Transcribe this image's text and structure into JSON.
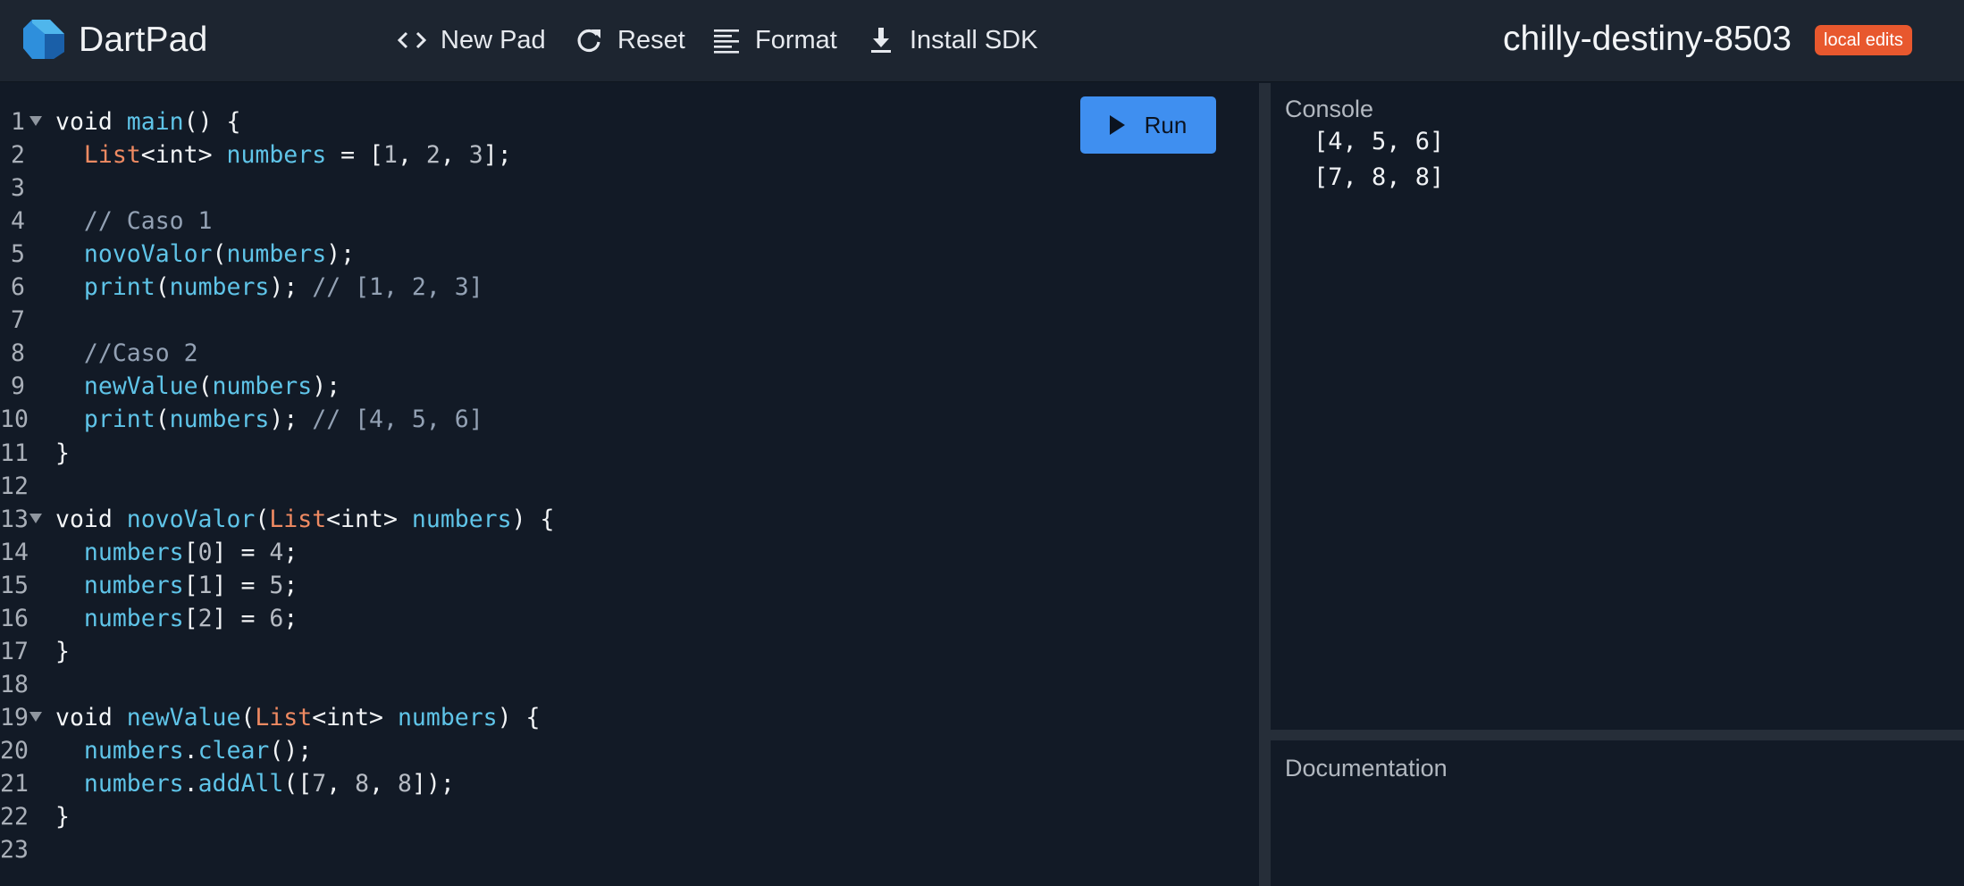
{
  "app": {
    "title": "DartPad",
    "pad_name": "chilly-destiny-8503",
    "badge": "local edits",
    "colors": {
      "header_bg": "#1d2530",
      "editor_bg": "#121a26",
      "run": "#3f8ff0",
      "badge": "#e8582e"
    }
  },
  "toolbar": {
    "new_pad": {
      "label": "New Pad",
      "icon": "code-brackets-icon"
    },
    "reset": {
      "label": "Reset",
      "icon": "refresh-icon"
    },
    "format": {
      "label": "Format",
      "icon": "format-align-icon"
    },
    "install": {
      "label": "Install SDK",
      "icon": "download-icon"
    }
  },
  "editor": {
    "run_label": "Run",
    "lines": [
      {
        "n": "1",
        "fold": true,
        "tokens": [
          [
            "kw",
            "void "
          ],
          [
            "fn",
            "main"
          ],
          [
            "pl",
            "() {"
          ]
        ]
      },
      {
        "n": "2",
        "fold": false,
        "tokens": [
          [
            "pl",
            "  "
          ],
          [
            "ty",
            "List"
          ],
          [
            "pl",
            "<int> "
          ],
          [
            "fn",
            "numbers"
          ],
          [
            "pl",
            " = ["
          ],
          [
            "num",
            "1"
          ],
          [
            "pl",
            ", "
          ],
          [
            "num",
            "2"
          ],
          [
            "pl",
            ", "
          ],
          [
            "num",
            "3"
          ],
          [
            "pl",
            "];"
          ]
        ]
      },
      {
        "n": "3",
        "fold": false,
        "tokens": []
      },
      {
        "n": "4",
        "fold": false,
        "tokens": [
          [
            "pl",
            "  "
          ],
          [
            "cm",
            "// Caso 1"
          ]
        ]
      },
      {
        "n": "5",
        "fold": false,
        "tokens": [
          [
            "pl",
            "  "
          ],
          [
            "fn",
            "novoValor"
          ],
          [
            "pl",
            "("
          ],
          [
            "fn",
            "numbers"
          ],
          [
            "pl",
            ");"
          ]
        ]
      },
      {
        "n": "6",
        "fold": false,
        "tokens": [
          [
            "pl",
            "  "
          ],
          [
            "fn",
            "print"
          ],
          [
            "pl",
            "("
          ],
          [
            "fn",
            "numbers"
          ],
          [
            "pl",
            "); "
          ],
          [
            "cm",
            "// [1, 2, 3]"
          ]
        ]
      },
      {
        "n": "7",
        "fold": false,
        "tokens": []
      },
      {
        "n": "8",
        "fold": false,
        "tokens": [
          [
            "pl",
            "  "
          ],
          [
            "cm",
            "//Caso 2"
          ]
        ]
      },
      {
        "n": "9",
        "fold": false,
        "tokens": [
          [
            "pl",
            "  "
          ],
          [
            "fn",
            "newValue"
          ],
          [
            "pl",
            "("
          ],
          [
            "fn",
            "numbers"
          ],
          [
            "pl",
            ");"
          ]
        ]
      },
      {
        "n": "10",
        "fold": false,
        "tokens": [
          [
            "pl",
            "  "
          ],
          [
            "fn",
            "print"
          ],
          [
            "pl",
            "("
          ],
          [
            "fn",
            "numbers"
          ],
          [
            "pl",
            "); "
          ],
          [
            "cm",
            "// [4, 5, 6]"
          ]
        ]
      },
      {
        "n": "11",
        "fold": false,
        "tokens": [
          [
            "pl",
            "}"
          ]
        ]
      },
      {
        "n": "12",
        "fold": false,
        "tokens": []
      },
      {
        "n": "13",
        "fold": true,
        "tokens": [
          [
            "kw",
            "void "
          ],
          [
            "fn",
            "novoValor"
          ],
          [
            "pl",
            "("
          ],
          [
            "ty",
            "List"
          ],
          [
            "pl",
            "<int> "
          ],
          [
            "fn",
            "numbers"
          ],
          [
            "pl",
            ") {"
          ]
        ]
      },
      {
        "n": "14",
        "fold": false,
        "tokens": [
          [
            "pl",
            "  "
          ],
          [
            "fn",
            "numbers"
          ],
          [
            "pl",
            "["
          ],
          [
            "num",
            "0"
          ],
          [
            "pl",
            "] = "
          ],
          [
            "num",
            "4"
          ],
          [
            "pl",
            ";"
          ]
        ]
      },
      {
        "n": "15",
        "fold": false,
        "tokens": [
          [
            "pl",
            "  "
          ],
          [
            "fn",
            "numbers"
          ],
          [
            "pl",
            "["
          ],
          [
            "num",
            "1"
          ],
          [
            "pl",
            "] = "
          ],
          [
            "num",
            "5"
          ],
          [
            "pl",
            ";"
          ]
        ]
      },
      {
        "n": "16",
        "fold": false,
        "tokens": [
          [
            "pl",
            "  "
          ],
          [
            "fn",
            "numbers"
          ],
          [
            "pl",
            "["
          ],
          [
            "num",
            "2"
          ],
          [
            "pl",
            "] = "
          ],
          [
            "num",
            "6"
          ],
          [
            "pl",
            ";"
          ]
        ]
      },
      {
        "n": "17",
        "fold": false,
        "tokens": [
          [
            "pl",
            "}"
          ]
        ]
      },
      {
        "n": "18",
        "fold": false,
        "tokens": []
      },
      {
        "n": "19",
        "fold": true,
        "tokens": [
          [
            "kw",
            "void "
          ],
          [
            "fn",
            "newValue"
          ],
          [
            "pl",
            "("
          ],
          [
            "ty",
            "List"
          ],
          [
            "pl",
            "<int> "
          ],
          [
            "fn",
            "numbers"
          ],
          [
            "pl",
            ") {"
          ]
        ]
      },
      {
        "n": "20",
        "fold": false,
        "tokens": [
          [
            "pl",
            "  "
          ],
          [
            "fn",
            "numbers"
          ],
          [
            "pl",
            "."
          ],
          [
            "fn",
            "clear"
          ],
          [
            "pl",
            "();"
          ]
        ]
      },
      {
        "n": "21",
        "fold": false,
        "tokens": [
          [
            "pl",
            "  "
          ],
          [
            "fn",
            "numbers"
          ],
          [
            "pl",
            "."
          ],
          [
            "fn",
            "addAll"
          ],
          [
            "pl",
            "(["
          ],
          [
            "num",
            "7"
          ],
          [
            "pl",
            ", "
          ],
          [
            "num",
            "8"
          ],
          [
            "pl",
            ", "
          ],
          [
            "num",
            "8"
          ],
          [
            "pl",
            "]);"
          ]
        ]
      },
      {
        "n": "22",
        "fold": false,
        "tokens": [
          [
            "pl",
            "}"
          ]
        ]
      },
      {
        "n": "23",
        "fold": false,
        "tokens": []
      }
    ]
  },
  "console": {
    "title": "Console",
    "output": [
      "[4, 5, 6]",
      "[7, 8, 8]"
    ]
  },
  "docs": {
    "title": "Documentation"
  }
}
